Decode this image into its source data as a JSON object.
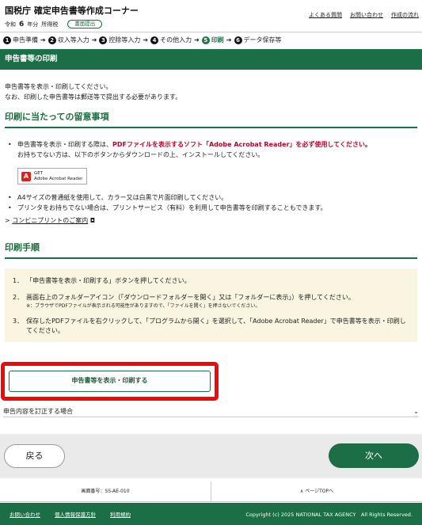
{
  "header": {
    "title": "国税庁 確定申告書等作成コーナー",
    "year_prefix": "令和",
    "year_num": "6",
    "year_suffix": "年分",
    "tax_type": "所得税",
    "badge": "書面提出",
    "links": [
      "よくある質問",
      "お問い合わせ",
      "作成の流れ"
    ]
  },
  "steps": [
    {
      "num": "1",
      "label": "申告準備",
      "active": false
    },
    {
      "num": "2",
      "label": "収入等入力",
      "active": false
    },
    {
      "num": "3",
      "label": "控除等入力",
      "active": false
    },
    {
      "num": "4",
      "label": "その他入力",
      "active": false
    },
    {
      "num": "5",
      "label": "印刷",
      "active": true
    },
    {
      "num": "6",
      "label": "データ保存等",
      "active": false
    }
  ],
  "banner": "申告書等の印刷",
  "intro": {
    "line1": "申告書等を表示・印刷してください。",
    "line2": "なお、印刷した申告書等は郵送等で提出する必要があります。"
  },
  "notes_heading": "印刷に当たっての留意事項",
  "notes": {
    "item1_a": "申告書等を表示・印刷する際は、",
    "item1_red": "PDFファイルを表示するソフト「Adobe Acrobat Reader」を必ず使用してください。",
    "item1_b": "お持ちでない方は、以下のボタンからダウンロードの上、インストールしてください。",
    "adobe_small": "GET",
    "adobe_label": "Adobe Acrobat Reader",
    "item2": "A4サイズの普通紙を使用して、カラー又は白黒で片面印刷してください。",
    "item3": "プリンタをお持ちでない場合は、プリントサービス（有料）を利用して申告書等を印刷することもできます。",
    "convini_link": "コンビニプリントのご案内"
  },
  "procedure_heading": "印刷手順",
  "procedure": {
    "step1_num": "1．",
    "step1": "「申告書等を表示・印刷する」ボタンを押してください。",
    "step2_num": "2．",
    "step2": "画面右上のフォルダーアイコン（「ダウンロードフォルダーを開く」又は「フォルダーに表示」）を押してください。",
    "step2_note": "※：ブラウザでPDFファイルが表示される可能性がありますので、「ファイルを開く」を押さないでください。",
    "step3_num": "3．",
    "step3": "保存したPDFファイルを右クリックして、「プログラムから開く」を選択して、「Adobe Acrobat Reader」で申告書等を表示・印刷してください。"
  },
  "print_button": "申告書等を表示・印刷する",
  "correction_label": "申告内容を訂正する場合",
  "nav": {
    "back": "戻る",
    "next": "次へ"
  },
  "page_info": {
    "screen_no": "画面番号：SS-AE-010",
    "page_top": "ページTOPへ"
  },
  "footer": {
    "links": [
      "お問い合わせ",
      "個人情報保護方針",
      "利用規約"
    ],
    "copyright": "Copyright (c) 2025 NATIONAL TAX AGENCY　All Rights Reserved."
  },
  "colors": {
    "brand_green": "#1b6e45",
    "alert_red": "#c0002a",
    "highlight_border": "#ee0a0a",
    "procedure_bg": "#faf5e1"
  }
}
